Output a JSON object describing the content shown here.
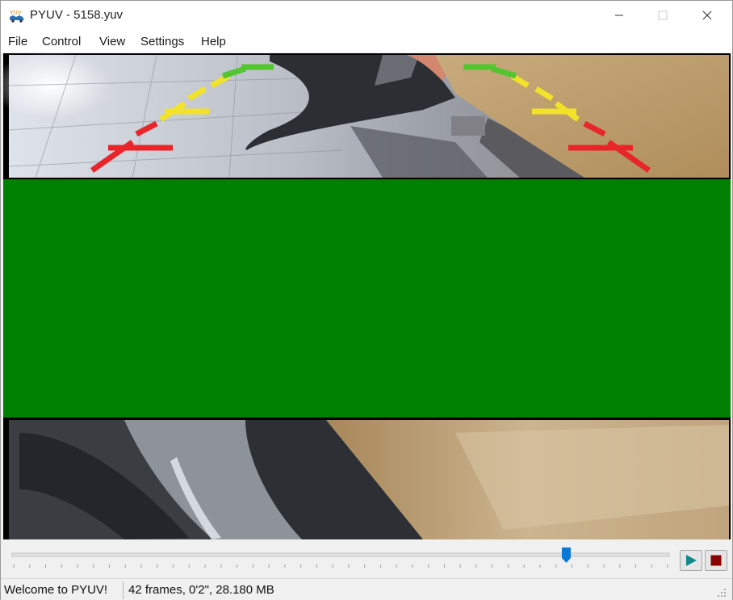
{
  "window": {
    "title": "PYUV - 5158.yuv",
    "icon": "pyuv-app-icon"
  },
  "menu": {
    "items": [
      "File",
      "Control",
      "View",
      "Settings",
      "Help"
    ]
  },
  "video": {
    "overlay_color": "#008000",
    "guide_colors": [
      "#e8262a",
      "#f2e22a",
      "#52c52f"
    ]
  },
  "playback": {
    "position_fraction": 0.845,
    "play_color": "#138a8a",
    "stop_color": "#8b0000"
  },
  "status": {
    "message": "Welcome to PYUV!",
    "info": "42 frames, 0'2\", 28.180 MB"
  }
}
